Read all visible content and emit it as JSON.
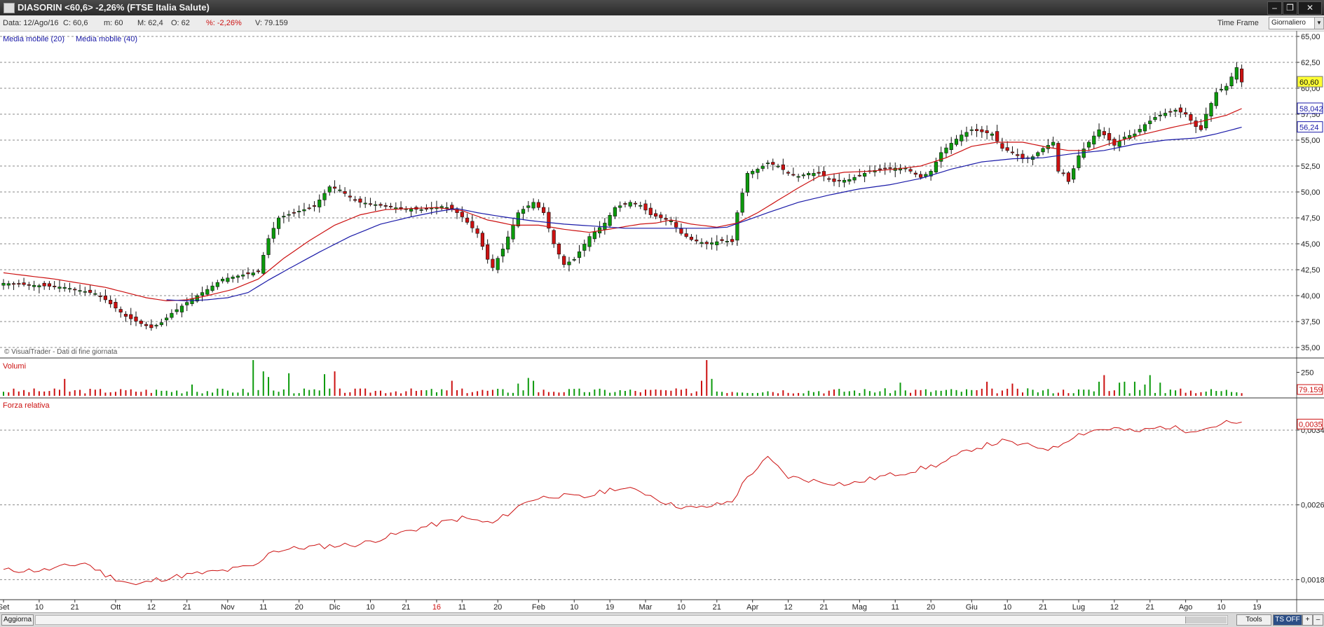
{
  "window": {
    "title": "DIASORIN <60,6> -2,26%  (FTSE Italia Salute)",
    "minimize": "–",
    "restore": "❐",
    "close": "✕"
  },
  "infobar": {
    "date": "Data: 12/Ago/16",
    "close": "C: 60,6",
    "min": "m: 60",
    "max": "M: 62,4",
    "open": "O: 62",
    "pct": "%: -2,26%",
    "volume": "V: 79.159",
    "timeframe_label": "Time Frame",
    "timeframe_value": "Giornaliero"
  },
  "bottombar": {
    "refresh": "Aggiorna",
    "tools": "Tools",
    "ts": "TS OFF",
    "plus": "+",
    "minus": "–"
  },
  "colors": {
    "up": "#0c9a0c",
    "down": "#cc1111",
    "ma20": "#cc1111",
    "ma40": "#1a1aa8",
    "rs": "#cc1111",
    "grid": "#8a8a8a"
  },
  "chart_data": [
    {
      "type": "candlestick",
      "title": "",
      "legend": [
        "Media mobile (20)",
        "Media mobile (40)"
      ],
      "watermark": "© VisualTrader - Dati di fine giornata",
      "ylim": [
        35,
        65
      ],
      "yticks": [
        "65,00",
        "62,50",
        "60,00",
        "57,50",
        "55,00",
        "52,50",
        "50,00",
        "47,50",
        "45,00",
        "42,50",
        "40,00",
        "37,50",
        "35,00"
      ],
      "last_price_label": "60,60",
      "ma20_label": "58,042",
      "ma40_label": "56,24",
      "x_labels": [
        {
          "bar": 0,
          "text": "Set",
          "red": false
        },
        {
          "bar": 7,
          "text": "10",
          "red": false
        },
        {
          "bar": 14,
          "text": "21",
          "red": false
        },
        {
          "bar": 22,
          "text": "Ott",
          "red": false
        },
        {
          "bar": 29,
          "text": "12",
          "red": false
        },
        {
          "bar": 36,
          "text": "21",
          "red": false
        },
        {
          "bar": 44,
          "text": "Nov",
          "red": false
        },
        {
          "bar": 51,
          "text": "11",
          "red": false
        },
        {
          "bar": 58,
          "text": "20",
          "red": false
        },
        {
          "bar": 65,
          "text": "Dic",
          "red": false
        },
        {
          "bar": 72,
          "text": "10",
          "red": false
        },
        {
          "bar": 79,
          "text": "21",
          "red": false
        },
        {
          "bar": 85,
          "text": "16",
          "red": true
        },
        {
          "bar": 90,
          "text": "11",
          "red": false
        },
        {
          "bar": 97,
          "text": "20",
          "red": false
        },
        {
          "bar": 105,
          "text": "Feb",
          "red": false
        },
        {
          "bar": 112,
          "text": "10",
          "red": false
        },
        {
          "bar": 119,
          "text": "19",
          "red": false
        },
        {
          "bar": 126,
          "text": "Mar",
          "red": false
        },
        {
          "bar": 133,
          "text": "10",
          "red": false
        },
        {
          "bar": 140,
          "text": "21",
          "red": false
        },
        {
          "bar": 147,
          "text": "Apr",
          "red": false
        },
        {
          "bar": 154,
          "text": "12",
          "red": false
        },
        {
          "bar": 161,
          "text": "21",
          "red": false
        },
        {
          "bar": 168,
          "text": "Mag",
          "red": false
        },
        {
          "bar": 175,
          "text": "11",
          "red": false
        },
        {
          "bar": 182,
          "text": "20",
          "red": false
        },
        {
          "bar": 190,
          "text": "Giu",
          "red": false
        },
        {
          "bar": 197,
          "text": "10",
          "red": false
        },
        {
          "bar": 204,
          "text": "21",
          "red": false
        },
        {
          "bar": 211,
          "text": "Lug",
          "red": false
        },
        {
          "bar": 218,
          "text": "12",
          "red": false
        },
        {
          "bar": 225,
          "text": "21",
          "red": false
        },
        {
          "bar": 232,
          "text": "Ago",
          "red": false
        },
        {
          "bar": 239,
          "text": "10",
          "red": false
        },
        {
          "bar": 246,
          "text": "19",
          "red": false
        }
      ],
      "close_anchors": [
        [
          0,
          41.2
        ],
        [
          6,
          41.0
        ],
        [
          12,
          40.8
        ],
        [
          18,
          40.2
        ],
        [
          20,
          39.6
        ],
        [
          24,
          38.0
        ],
        [
          27,
          37.3
        ],
        [
          29,
          36.9
        ],
        [
          31,
          37.4
        ],
        [
          33,
          38.3
        ],
        [
          35,
          39.0
        ],
        [
          37,
          39.7
        ],
        [
          40,
          40.6
        ],
        [
          43,
          41.6
        ],
        [
          47,
          42.0
        ],
        [
          50,
          42.3
        ],
        [
          52,
          45.5
        ],
        [
          54,
          47.5
        ],
        [
          57,
          48.0
        ],
        [
          61,
          48.6
        ],
        [
          64,
          50.5
        ],
        [
          66,
          50.2
        ],
        [
          68,
          49.5
        ],
        [
          70,
          49.0
        ],
        [
          74,
          48.7
        ],
        [
          78,
          48.4
        ],
        [
          82,
          48.3
        ],
        [
          86,
          48.6
        ],
        [
          88,
          48.4
        ],
        [
          90,
          47.6
        ],
        [
          93,
          46.0
        ],
        [
          95,
          43.5
        ],
        [
          96,
          42.7
        ],
        [
          98,
          44.5
        ],
        [
          101,
          48.0
        ],
        [
          104,
          49.0
        ],
        [
          106,
          48.0
        ],
        [
          108,
          45.0
        ],
        [
          110,
          43.0
        ],
        [
          112,
          43.5
        ],
        [
          115,
          45.7
        ],
        [
          118,
          47.0
        ],
        [
          120,
          48.5
        ],
        [
          123,
          49.0
        ],
        [
          125,
          48.7
        ],
        [
          127,
          47.8
        ],
        [
          129,
          47.5
        ],
        [
          131,
          47.2
        ],
        [
          133,
          46.0
        ],
        [
          135,
          45.4
        ],
        [
          138,
          45.0
        ],
        [
          141,
          45.3
        ],
        [
          143,
          45.2
        ],
        [
          144,
          48.0
        ],
        [
          146,
          51.8
        ],
        [
          148,
          52.2
        ],
        [
          150,
          52.8
        ],
        [
          152,
          52.5
        ],
        [
          154,
          51.8
        ],
        [
          156,
          51.5
        ],
        [
          158,
          51.8
        ],
        [
          160,
          51.8
        ],
        [
          163,
          51.0
        ],
        [
          166,
          51.2
        ],
        [
          170,
          52.0
        ],
        [
          174,
          52.3
        ],
        [
          177,
          52.3
        ],
        [
          180,
          51.4
        ],
        [
          182,
          52.0
        ],
        [
          184,
          53.8
        ],
        [
          186,
          54.7
        ],
        [
          188,
          55.5
        ],
        [
          190,
          56.0
        ],
        [
          192,
          55.8
        ],
        [
          194,
          55.6
        ],
        [
          196,
          54.2
        ],
        [
          198,
          53.8
        ],
        [
          200,
          53.2
        ],
        [
          202,
          53.4
        ],
        [
          204,
          54.2
        ],
        [
          206,
          54.8
        ],
        [
          207,
          52.0
        ],
        [
          208,
          51.8
        ],
        [
          209,
          51.0
        ],
        [
          211,
          53.5
        ],
        [
          213,
          54.8
        ],
        [
          215,
          56.0
        ],
        [
          216,
          55.5
        ],
        [
          218,
          54.5
        ],
        [
          220,
          55.3
        ],
        [
          222,
          55.6
        ],
        [
          224,
          56.5
        ],
        [
          226,
          57.2
        ],
        [
          228,
          57.6
        ],
        [
          230,
          57.9
        ],
        [
          232,
          57.5
        ],
        [
          234,
          56.3
        ],
        [
          235,
          56.0
        ],
        [
          236,
          57.5
        ],
        [
          238,
          59.6
        ],
        [
          240,
          60.2
        ],
        [
          241,
          61.1
        ],
        [
          242,
          62.0
        ],
        [
          243,
          60.6
        ]
      ],
      "ma20_anchors": [
        [
          0,
          42.2
        ],
        [
          10,
          41.6
        ],
        [
          20,
          40.8
        ],
        [
          28,
          39.8
        ],
        [
          32,
          39.5
        ],
        [
          36,
          39.6
        ],
        [
          40,
          40.0
        ],
        [
          45,
          40.6
        ],
        [
          50,
          41.6
        ],
        [
          55,
          43.6
        ],
        [
          60,
          45.3
        ],
        [
          65,
          46.8
        ],
        [
          70,
          47.8
        ],
        [
          75,
          48.3
        ],
        [
          80,
          48.4
        ],
        [
          85,
          48.5
        ],
        [
          90,
          48.2
        ],
        [
          95,
          47.3
        ],
        [
          100,
          46.8
        ],
        [
          105,
          46.8
        ],
        [
          110,
          46.4
        ],
        [
          115,
          46.1
        ],
        [
          120,
          46.5
        ],
        [
          125,
          46.9
        ],
        [
          128,
          47.0
        ],
        [
          131,
          47.3
        ],
        [
          135,
          46.9
        ],
        [
          140,
          46.6
        ],
        [
          144,
          47.0
        ],
        [
          148,
          48.0
        ],
        [
          152,
          49.2
        ],
        [
          156,
          50.4
        ],
        [
          160,
          51.5
        ],
        [
          165,
          51.9
        ],
        [
          170,
          52.0
        ],
        [
          175,
          52.2
        ],
        [
          180,
          52.5
        ],
        [
          185,
          53.3
        ],
        [
          190,
          54.4
        ],
        [
          195,
          54.8
        ],
        [
          200,
          54.8
        ],
        [
          205,
          54.3
        ],
        [
          209,
          54.0
        ],
        [
          213,
          54.0
        ],
        [
          218,
          54.8
        ],
        [
          224,
          55.6
        ],
        [
          230,
          56.3
        ],
        [
          235,
          56.8
        ],
        [
          240,
          57.4
        ],
        [
          243,
          58.04
        ]
      ],
      "ma40_anchors": [
        [
          32,
          39.6
        ],
        [
          36,
          39.5
        ],
        [
          40,
          39.6
        ],
        [
          44,
          39.8
        ],
        [
          48,
          40.3
        ],
        [
          52,
          41.5
        ],
        [
          56,
          42.6
        ],
        [
          62,
          44.2
        ],
        [
          68,
          45.7
        ],
        [
          74,
          46.9
        ],
        [
          80,
          47.6
        ],
        [
          85,
          48.1
        ],
        [
          89,
          48.4
        ],
        [
          93,
          48.0
        ],
        [
          98,
          47.6
        ],
        [
          104,
          47.2
        ],
        [
          110,
          46.9
        ],
        [
          116,
          46.7
        ],
        [
          122,
          46.5
        ],
        [
          128,
          46.5
        ],
        [
          134,
          46.5
        ],
        [
          138,
          46.5
        ],
        [
          142,
          46.6
        ],
        [
          146,
          47.3
        ],
        [
          150,
          48.0
        ],
        [
          156,
          49.0
        ],
        [
          162,
          49.7
        ],
        [
          168,
          50.3
        ],
        [
          174,
          50.7
        ],
        [
          180,
          51.3
        ],
        [
          186,
          52.2
        ],
        [
          192,
          52.9
        ],
        [
          198,
          53.2
        ],
        [
          204,
          53.3
        ],
        [
          210,
          53.7
        ],
        [
          216,
          54.0
        ],
        [
          222,
          54.6
        ],
        [
          228,
          55.0
        ],
        [
          234,
          55.2
        ],
        [
          238,
          55.6
        ],
        [
          243,
          56.24
        ]
      ]
    },
    {
      "type": "bar",
      "title": "Volumi",
      "ytick": "250",
      "ymax": 380,
      "last_label": "79.159",
      "spikes": [
        [
          12,
          180
        ],
        [
          37,
          120
        ],
        [
          49,
          380
        ],
        [
          51,
          260
        ],
        [
          52,
          200
        ],
        [
          56,
          240
        ],
        [
          63,
          230
        ],
        [
          65,
          260
        ],
        [
          88,
          160
        ],
        [
          101,
          130
        ],
        [
          103,
          190
        ],
        [
          104,
          160
        ],
        [
          137,
          160
        ],
        [
          138,
          380
        ],
        [
          139,
          180
        ],
        [
          176,
          140
        ],
        [
          193,
          150
        ],
        [
          198,
          130
        ],
        [
          215,
          150
        ],
        [
          216,
          220
        ],
        [
          219,
          140
        ],
        [
          220,
          150
        ],
        [
          222,
          150
        ],
        [
          224,
          120
        ],
        [
          225,
          220
        ],
        [
          227,
          140
        ],
        [
          247,
          140
        ],
        [
          248,
          100
        ],
        [
          249,
          110
        ]
      ]
    },
    {
      "type": "line",
      "title": "Forza relativa",
      "ylim": [
        0.0016,
        0.0037
      ],
      "yticks": [
        "0,0034",
        "0,0026",
        "0,0018"
      ],
      "last_label": "0,0035",
      "anchors": [
        [
          0,
          0.0019
        ],
        [
          8,
          0.0019
        ],
        [
          16,
          0.00198
        ],
        [
          20,
          0.00185
        ],
        [
          26,
          0.00174
        ],
        [
          30,
          0.0018
        ],
        [
          36,
          0.00185
        ],
        [
          44,
          0.0019
        ],
        [
          50,
          0.00196
        ],
        [
          52,
          0.0021
        ],
        [
          60,
          0.00215
        ],
        [
          70,
          0.00218
        ],
        [
          80,
          0.00233
        ],
        [
          90,
          0.00246
        ],
        [
          96,
          0.0024
        ],
        [
          103,
          0.00265
        ],
        [
          108,
          0.0027
        ],
        [
          114,
          0.00268
        ],
        [
          120,
          0.00278
        ],
        [
          125,
          0.00275
        ],
        [
          131,
          0.0026
        ],
        [
          136,
          0.00256
        ],
        [
          140,
          0.0026
        ],
        [
          143,
          0.00264
        ],
        [
          146,
          0.0029
        ],
        [
          150,
          0.0031
        ],
        [
          154,
          0.0029
        ],
        [
          160,
          0.00285
        ],
        [
          166,
          0.00282
        ],
        [
          172,
          0.0029
        ],
        [
          178,
          0.00296
        ],
        [
          184,
          0.00304
        ],
        [
          190,
          0.0032
        ],
        [
          196,
          0.00328
        ],
        [
          200,
          0.00324
        ],
        [
          206,
          0.0032
        ],
        [
          210,
          0.00334
        ],
        [
          214,
          0.0034
        ],
        [
          218,
          0.00342
        ],
        [
          222,
          0.00338
        ],
        [
          228,
          0.00344
        ],
        [
          232,
          0.0034
        ],
        [
          236,
          0.00342
        ],
        [
          240,
          0.00348
        ],
        [
          243,
          0.00346
        ]
      ]
    }
  ]
}
